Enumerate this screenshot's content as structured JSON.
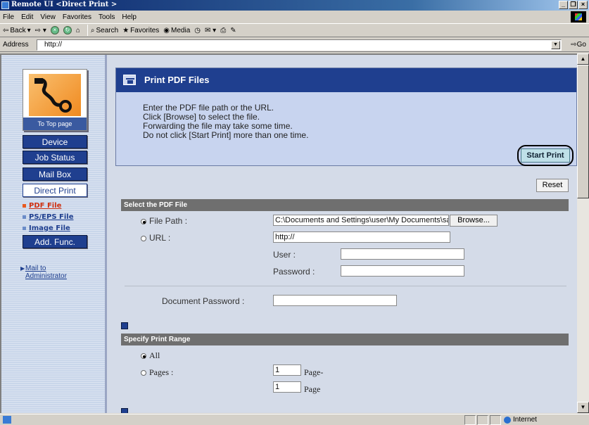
{
  "window": {
    "title": "Remote UI <Direct Print >"
  },
  "menu": [
    "File",
    "Edit",
    "View",
    "Favorites",
    "Tools",
    "Help"
  ],
  "toolbar": {
    "back": "Back",
    "search": "Search",
    "favorites": "Favorites",
    "media": "Media"
  },
  "address": {
    "label": "Address",
    "value": "http://",
    "go": "Go"
  },
  "nav": {
    "logo_caption": "To Top page",
    "buttons": [
      "Device",
      "Job Status",
      "Mail Box",
      "Direct Print"
    ],
    "sublinks": [
      "PDF File",
      "PS/EPS File",
      "Image File"
    ],
    "addfunc": "Add. Func.",
    "mail": [
      "Mail to",
      "Administrator"
    ]
  },
  "header": {
    "title": "Print PDF Files",
    "instructions": [
      "Enter the PDF file path or the URL.",
      "Click [Browse] to select the file.",
      "Forwarding the file may take some time.",
      "Do not click [Start Print] more than one time."
    ],
    "start_print": "Start Print"
  },
  "reset": "Reset",
  "select_file": {
    "heading": "Select the PDF File",
    "file_path_label": "File Path :",
    "file_path_value": "C:\\Documents and Settings\\user\\My Documents\\sar",
    "browse": "Browse...",
    "url_label": "URL :",
    "url_value": "http://",
    "user_label": "User :",
    "password_label": "Password :",
    "doc_password_label": "Document Password :"
  },
  "print_range": {
    "heading": "Specify Print Range",
    "all_label": "All",
    "pages_label": "Pages :",
    "from_value": "1",
    "from_suffix": "Page-",
    "to_value": "1",
    "to_suffix": "Page"
  },
  "status": {
    "zone": "Internet"
  }
}
